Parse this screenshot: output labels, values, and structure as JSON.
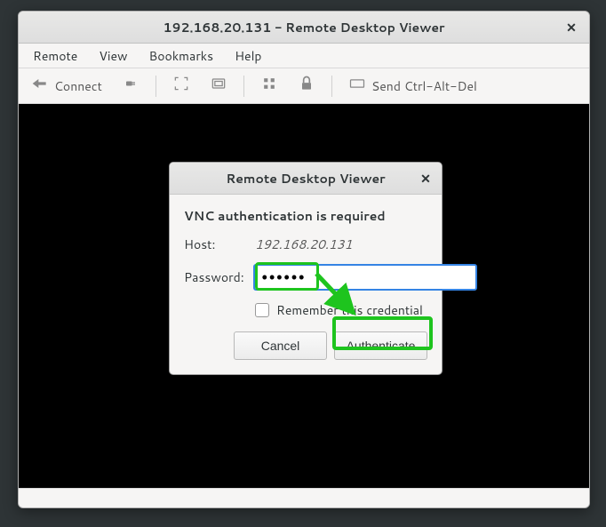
{
  "window": {
    "title": "192.168.20.131 - Remote Desktop Viewer"
  },
  "menubar": {
    "remote": "Remote",
    "view": "View",
    "bookmarks": "Bookmarks",
    "help": "Help"
  },
  "toolbar": {
    "connect_label": "Connect",
    "ctrlaltdel_label": "Send Ctrl-Alt-Del"
  },
  "dialog": {
    "title": "Remote Desktop Viewer",
    "heading": "VNC authentication is required",
    "host_label": "Host:",
    "host_value": "192.168.20.131",
    "password_label": "Password:",
    "password_value": "••••••",
    "remember_label": "Remember this credential",
    "cancel_label": "Cancel",
    "authenticate_label": "Authenticate"
  }
}
